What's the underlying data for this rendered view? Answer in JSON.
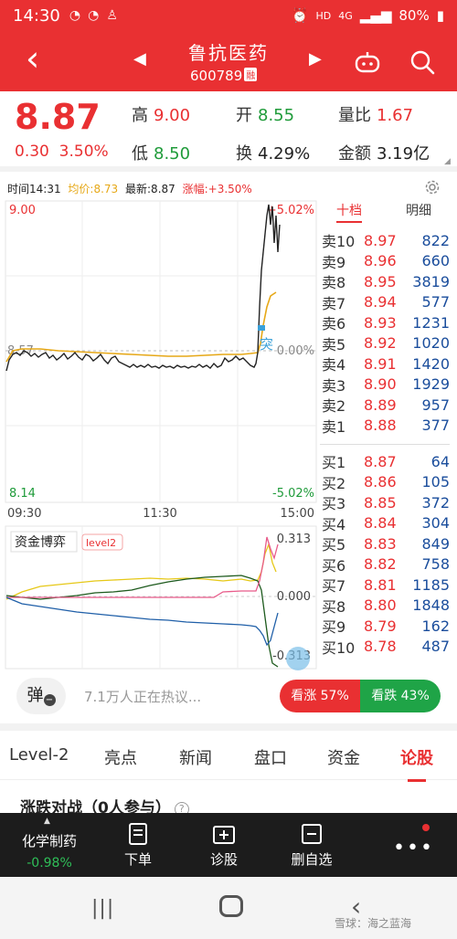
{
  "status_bar": {
    "time": "14:30",
    "network": "HD",
    "signal": "4G",
    "battery": "80%"
  },
  "header": {
    "back_icon": "chevron-left-icon",
    "stock_name": "鲁抗医药",
    "stock_code": "600789",
    "tag": "融"
  },
  "quote": {
    "price": "8.87",
    "change": "0.30",
    "change_pct": "3.50%",
    "high_label": "高",
    "high": "9.00",
    "open_label": "开",
    "open": "8.55",
    "vol_ratio_label": "量比",
    "vol_ratio": "1.67",
    "low_label": "低",
    "low": "8.50",
    "turnover_label": "换",
    "turnover": "4.29%",
    "amount_label": "金额",
    "amount": "3.19亿"
  },
  "intraday": {
    "time_label": "时间14:31",
    "avg_label": "均价:8.73",
    "latest_label": "最新:8.87",
    "chg_label": "涨幅:+3.50%",
    "y_top": "9.00",
    "y_mid": "8.57",
    "y_bot": "8.14",
    "pct_top": "+5.02%",
    "pct_mid": "0.00%",
    "pct_bot": "-5.02%",
    "t_start": "09:30",
    "t_mid": "11:30",
    "t_end": "15:00",
    "marker": "突",
    "fund_title": "资金博弈",
    "fund_tag": "level2",
    "fund_top": "0.313",
    "fund_mid": "0.000",
    "fund_bot": "-0.313"
  },
  "order_book": {
    "tab_ten": "十档",
    "tab_detail": "明细",
    "asks": [
      {
        "label": "卖10",
        "price": "8.97",
        "vol": "822"
      },
      {
        "label": "卖9",
        "price": "8.96",
        "vol": "660"
      },
      {
        "label": "卖8",
        "price": "8.95",
        "vol": "3819"
      },
      {
        "label": "卖7",
        "price": "8.94",
        "vol": "577"
      },
      {
        "label": "卖6",
        "price": "8.93",
        "vol": "1231"
      },
      {
        "label": "卖5",
        "price": "8.92",
        "vol": "1020"
      },
      {
        "label": "卖4",
        "price": "8.91",
        "vol": "1420"
      },
      {
        "label": "卖3",
        "price": "8.90",
        "vol": "1929"
      },
      {
        "label": "卖2",
        "price": "8.89",
        "vol": "957"
      },
      {
        "label": "卖1",
        "price": "8.88",
        "vol": "377"
      }
    ],
    "bids": [
      {
        "label": "买1",
        "price": "8.87",
        "vol": "64"
      },
      {
        "label": "买2",
        "price": "8.86",
        "vol": "105"
      },
      {
        "label": "买3",
        "price": "8.85",
        "vol": "372"
      },
      {
        "label": "买4",
        "price": "8.84",
        "vol": "304"
      },
      {
        "label": "买5",
        "price": "8.83",
        "vol": "849"
      },
      {
        "label": "买6",
        "price": "8.82",
        "vol": "758"
      },
      {
        "label": "买7",
        "price": "8.81",
        "vol": "1185"
      },
      {
        "label": "买8",
        "price": "8.80",
        "vol": "1848"
      },
      {
        "label": "买9",
        "price": "8.79",
        "vol": "162"
      },
      {
        "label": "买10",
        "price": "8.78",
        "vol": "487"
      }
    ]
  },
  "hot": {
    "button": "弹",
    "text": "7.1万人正在热议...",
    "up_label": "看涨 57%",
    "down_label": "看跌 43%"
  },
  "lower_tabs": [
    "Level-2",
    "亮点",
    "新闻",
    "盘口",
    "资金",
    "论股"
  ],
  "battle": {
    "title": "涨跌对战（0人参与）"
  },
  "bottom_bar": {
    "index_name": "化学制药",
    "index_pct": "-0.98%",
    "order": "下单",
    "diagnose": "诊股",
    "remove_fav": "删自选"
  },
  "watermark": "雪球：海之蓝海",
  "colors": {
    "brand_red": "#e93032",
    "green": "#1fa447",
    "avg_line": "#e6a817"
  }
}
